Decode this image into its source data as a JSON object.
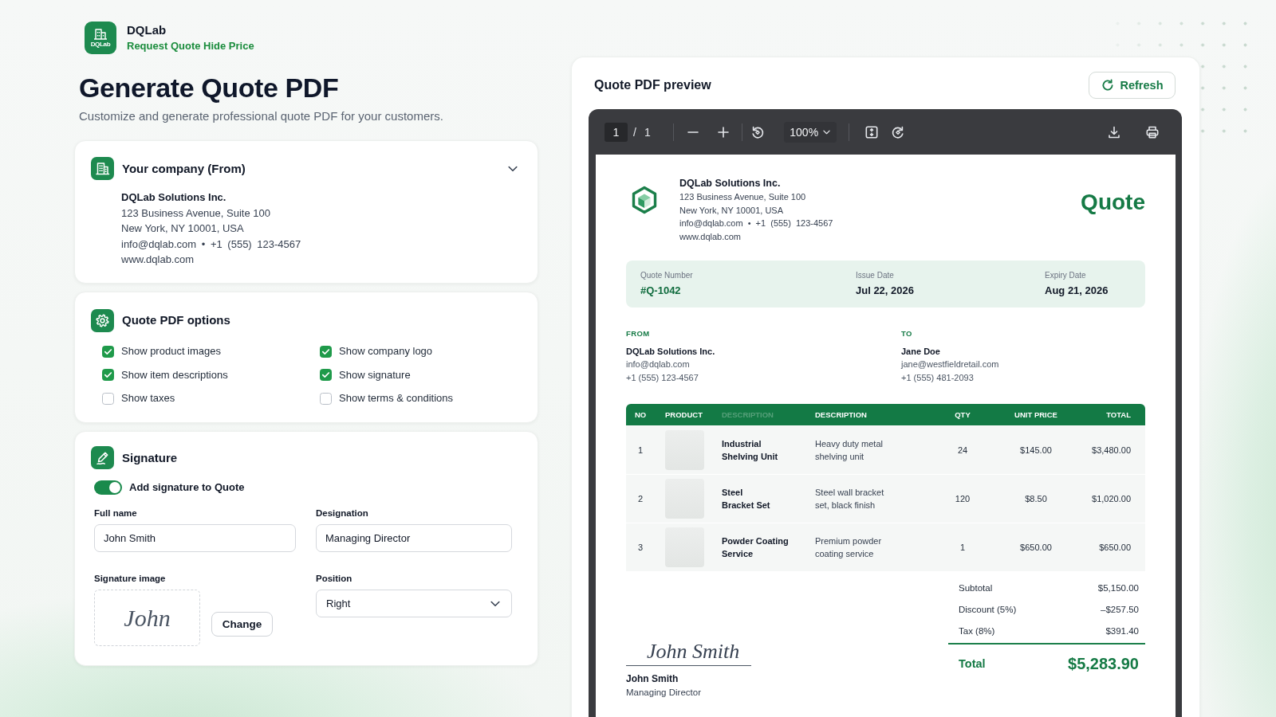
{
  "app": {
    "logo_text": "DQLab",
    "name": "DQLab",
    "tagline": "Request Quote Hide Price"
  },
  "page_header": {
    "title": "Generate Quote PDF",
    "subtitle": "Customize and generate professional quote PDF for your customers."
  },
  "company_card": {
    "title": "Your company (From)",
    "expanded": true,
    "name": "DQLab Solutions Inc.",
    "address": [
      "123 Business Avenue, Suite 100",
      "New York, NY 10001, USA"
    ],
    "contact": "info@dqlab.com • +1 (555) 123-4567",
    "website": "www.dqlab.com"
  },
  "options_card": {
    "title": "Quote PDF options",
    "options": [
      {
        "label": "Show product images",
        "checked": true
      },
      {
        "label": "Show company logo",
        "checked": true
      },
      {
        "label": "Show item descriptions",
        "checked": true
      },
      {
        "label": "Show signature",
        "checked": true
      },
      {
        "label": "Show taxes",
        "checked": false
      },
      {
        "label": "Show terms & conditions",
        "checked": false
      }
    ]
  },
  "signature_card": {
    "title": "Signature",
    "toggle": {
      "label": "Add signature to Quote",
      "on": true
    },
    "full_name": {
      "label": "Full name",
      "value": "John Smith"
    },
    "designation": {
      "label": "Designation",
      "value": "Managing Director"
    },
    "signature_image": {
      "label": "Signature image",
      "signature": "John",
      "button": "Change"
    },
    "position": {
      "label": "Position",
      "value": "Right"
    }
  },
  "preview": {
    "title": "Quote PDF preview",
    "refresh_label": "Refresh",
    "toolbar": {
      "page": "1",
      "separator": "/",
      "page_count": "1",
      "zoom": "100%"
    },
    "document": {
      "company_name": "DQLab Solutions Inc.",
      "address": [
        "123 Business Avenue, Suite 100",
        "New York, NY 10001, USA"
      ],
      "contact": "info@dqlab.com • +1 (555) 123-4567",
      "website": "www.dqlab.com",
      "doc_title": "Quote",
      "meta": [
        {
          "label": "Quote Number",
          "value": "#Q-1042",
          "accent": true
        },
        {
          "label": "Issue Date",
          "value": "Jul 22, 2026",
          "accent": false
        },
        {
          "label": "Expiry Date",
          "value": "Aug 21, 2026",
          "accent": false
        }
      ],
      "parties": [
        {
          "heading": "FROM",
          "name": "DQLab Solutions Inc.",
          "email": "info@dqlab.com",
          "phone": "+1 (555) 123-4567"
        },
        {
          "heading": "TO",
          "name": "Jane Doe",
          "email": "jane@westfieldretail.com",
          "phone": "+1 (555) 481-2093"
        }
      ],
      "table": {
        "columns": [
          {
            "label": "NO",
            "faded": false
          },
          {
            "label": "PRODUCT",
            "faded": false
          },
          {
            "label": "DESCRIPTION",
            "faded": true
          },
          {
            "label": "DESCRIPTION",
            "faded": false
          },
          {
            "label": "QTY",
            "faded": false
          },
          {
            "label": "UNIT PRICE",
            "faded": false
          },
          {
            "label": "TOTAL",
            "faded": false
          }
        ],
        "rows": [
          {
            "no": "1",
            "product": "Industrial\nShelving Unit",
            "description": "Heavy duty metal\nshelving unit",
            "qty": "24",
            "unit_price": "$145.00",
            "total": "$3,480.00"
          },
          {
            "no": "2",
            "product": "Steel\nBracket Set",
            "description": "Steel wall bracket\nset, black finish",
            "qty": "120",
            "unit_price": "$8.50",
            "total": "$1,020.00"
          },
          {
            "no": "3",
            "product": "Powder Coating\nService",
            "description": "Premium powder\ncoating service",
            "qty": "1",
            "unit_price": "$650.00",
            "total": "$650.00"
          }
        ]
      },
      "totals": [
        {
          "label": "Subtotal",
          "value": "$5,150.00"
        },
        {
          "label": "Discount (5%)",
          "value": "–$257.50"
        },
        {
          "label": "Tax (8%)",
          "value": "$391.40"
        }
      ],
      "grand_total": {
        "label": "Total",
        "value": "$5,283.90"
      },
      "signature": {
        "signature": "John Smith",
        "name": "John Smith",
        "role": "Managing Director"
      }
    }
  }
}
